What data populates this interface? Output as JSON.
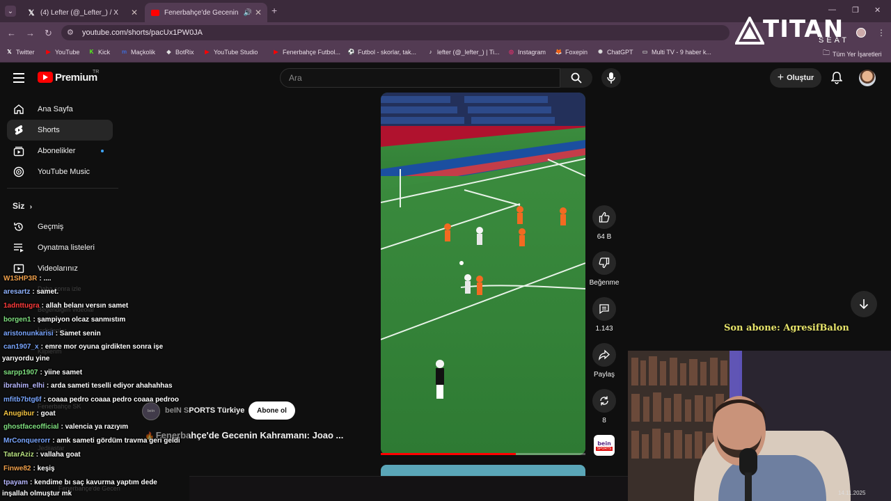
{
  "browser": {
    "tabs": [
      {
        "title": "(4) Lefter (@_Lefter_) / X",
        "icon": "x-logo"
      },
      {
        "title": "Fenerbahçe'de Gecenin",
        "icon": "youtube-logo"
      }
    ],
    "url": "youtube.com/shorts/pacUx1PW0JA",
    "bookmarks": [
      {
        "label": "Twitter",
        "color": "#ffffff"
      },
      {
        "label": "YouTube",
        "color": "#ff0000"
      },
      {
        "label": "Kick",
        "color": "#53fc18"
      },
      {
        "label": "Maçkolik",
        "color": "#3d6bd6"
      },
      {
        "label": "BotRix",
        "color": "#e0e0e0"
      },
      {
        "label": "YouTube Studio",
        "color": "#ff0000"
      },
      {
        "label": "Fenerbahçe Futbol...",
        "color": "#ff0000"
      },
      {
        "label": "Futbol - skorlar, tak...",
        "color": "#3d6bd6"
      },
      {
        "label": "lefter (@_lefter_) | Ti...",
        "color": "#ffffff"
      },
      {
        "label": "Instagram",
        "color": "#e1306c"
      },
      {
        "label": "Foxepin",
        "color": "#f59a1b"
      },
      {
        "label": "ChatGPT",
        "color": "#dddddd"
      },
      {
        "label": "Multi TV - 9 haber k...",
        "color": "#bbbbbb"
      }
    ],
    "all_bookmarks": "Tüm Yer İşaretleri"
  },
  "watermark": {
    "word": "TITAN",
    "sub": "SEAT"
  },
  "youtube": {
    "brand": "Premium",
    "region": "TR",
    "search_placeholder": "Ara",
    "create_label": "Oluştur",
    "sidebar": {
      "items": [
        {
          "label": "Ana Sayfa",
          "icon": "home-icon"
        },
        {
          "label": "Shorts",
          "icon": "shorts-icon"
        },
        {
          "label": "Abonelikler",
          "icon": "subscriptions-icon"
        },
        {
          "label": "YouTube Music",
          "icon": "music-icon"
        }
      ],
      "you_section": "Siz",
      "you_items": [
        {
          "label": "Geçmiş",
          "icon": "history-icon"
        },
        {
          "label": "Oynatma listeleri",
          "icon": "playlists-icon"
        },
        {
          "label": "Videolarınız",
          "icon": "your-videos-icon"
        },
        {
          "label": "Daha sonra izle",
          "icon": "watch-later-icon"
        },
        {
          "label": "Beğendiğim videolar",
          "icon": "liked-icon"
        },
        {
          "label": "İndirilenler",
          "icon": "downloads-icon"
        },
        {
          "label": "Kliplerim",
          "icon": "clips-icon"
        }
      ],
      "subs_faint": [
        "Fenerbahçe SK",
        "Jediiastar",
        "Fenerbahçe'de Gecen"
      ]
    },
    "short": {
      "channel": "beIN SPORTS Türkiye",
      "subscribe_label": "Abone ol",
      "title": "Fenerbahçe'de Gecenin Kahramanı: Joao ...",
      "progress": 0.66,
      "likes": "64 B",
      "dislike_label": "Beğenme",
      "comments": "1.143",
      "share_label": "Paylaş",
      "remix": "8"
    }
  },
  "chat": [
    {
      "user": "W1SHP3R",
      "color": "#f0a04b",
      "text": ": ...."
    },
    {
      "user": "aresartz",
      "color": "#8fb3ff",
      "text": ": samet."
    },
    {
      "user": "1adnttugra",
      "color": "#ff3b3b",
      "text": ": allah belanı versın samet"
    },
    {
      "user": "borgen1",
      "color": "#7fe07f",
      "text": ": şampiyon olcaz sanmıstım"
    },
    {
      "user": "aristonunkarisi",
      "color": "#7aa6ff",
      "text": ": Samet senin"
    },
    {
      "user": "can1907_x",
      "color": "#7aa6ff",
      "text": ": emre mor oyuna girdikten sonra işe"
    },
    {
      "user": "",
      "color": "#ffffff",
      "text": "yarıyordu yine"
    },
    {
      "user": "sarpp1907",
      "color": "#7fe07f",
      "text": ": yiine samet"
    },
    {
      "user": "ibrahim_elhi",
      "color": "#b7b7ff",
      "text": ": arda sameti teselli ediyor ahahahhas"
    },
    {
      "user": "mfitb7btg6f",
      "color": "#7aa6ff",
      "text": ": coaaa pedro coaaa pedro coaaa pedroo"
    },
    {
      "user": "Anugibur",
      "color": "#f5c542",
      "text": ": goat"
    },
    {
      "user": "ghostfaceofficial",
      "color": "#7fe07f",
      "text": ": valencia ya razıyım"
    },
    {
      "user": "MrConquerorr",
      "color": "#7aa6ff",
      "text": ": amk sameti gördüm travma geri geldi"
    },
    {
      "user": "TatarAziz",
      "color": "#b7e07f",
      "text": ": vallaha goat"
    },
    {
      "user": "Finwe82",
      "color": "#f0a04b",
      "text": ": keşiş"
    },
    {
      "user": "tpayam",
      "color": "#b7b7ff",
      "text": ": kendime bı saç kavurma yaptım dede"
    },
    {
      "user": "",
      "color": "#ffffff",
      "text": "inşallah olmuştur mk"
    }
  ],
  "last_sub": "Son abone: AgresifBalon",
  "webcam_timestamp": "14.11.2025"
}
